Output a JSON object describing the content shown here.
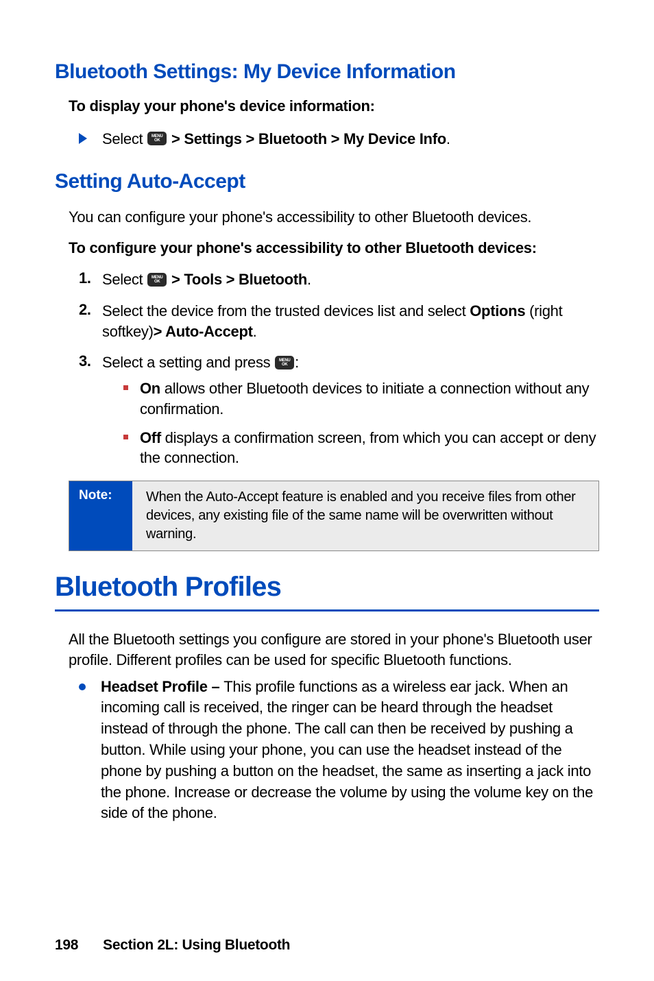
{
  "section_bt_settings": {
    "heading": "Bluetooth Settings: My Device Information",
    "subhead": "To display your phone's device information:",
    "step_prefix": "Select ",
    "step_path": " > Settings > Bluetooth > My Device Info",
    "step_suffix": "."
  },
  "section_auto_accept": {
    "heading": "Setting Auto-Accept",
    "intro": "You can configure your phone's accessibility to other Bluetooth devices.",
    "subhead": "To configure your phone's accessibility to other Bluetooth devices:",
    "steps": [
      {
        "num": "1.",
        "prefix": "Select ",
        "path": " > Tools > Bluetooth",
        "suffix": "."
      },
      {
        "num": "2.",
        "text_a": "Select the device from the trusted devices list and select ",
        "bold_a": "Options",
        "text_b": " (right softkey)",
        "bold_b": "> Auto-Accept",
        "text_c": "."
      },
      {
        "num": "3.",
        "prefix": "Select a setting and press ",
        "suffix": ":"
      }
    ],
    "sub_bullets": [
      {
        "bold": "On",
        "text": " allows other Bluetooth devices to initiate a connection without any confirmation."
      },
      {
        "bold": "Off",
        "text": " displays a confirmation screen, from which you can accept or deny the connection."
      }
    ],
    "note_label": "Note:",
    "note_text": "When the Auto-Accept feature is enabled and you receive files from other devices, any existing file of the same name will be overwritten without warning."
  },
  "section_profiles": {
    "heading": "Bluetooth Profiles",
    "intro": "All the Bluetooth settings you configure are stored in your phone's Bluetooth user profile. Different profiles can be used for specific Bluetooth functions.",
    "bullet_bold": "Headset Profile – ",
    "bullet_text": "This profile functions as a wireless ear jack. When an incoming call is received, the ringer can be heard through the headset instead of through the phone. The call can then be received by pushing a button. While using your phone, you can use the headset instead of the phone by pushing a button on the headset, the same as inserting a jack into the phone. Increase or decrease the volume by using the volume key on the side of the phone."
  },
  "footer": {
    "page": "198",
    "section": "Section 2L: Using Bluetooth"
  },
  "menu_key": {
    "line1": "MENU",
    "line2": "OK"
  }
}
